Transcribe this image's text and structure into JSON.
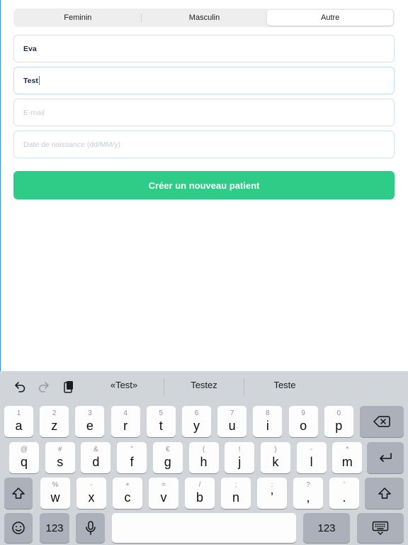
{
  "gender_segments": [
    {
      "label": "Feminin",
      "selected": false
    },
    {
      "label": "Masculin",
      "selected": false
    },
    {
      "label": "Autre",
      "selected": true
    }
  ],
  "form": {
    "first_name_value": "Eva",
    "last_name_value": "Test",
    "email_placeholder": "E-mail",
    "birthdate_placeholder": "Date de naissance (dd/MM/y)"
  },
  "create_button_label": "Créer un nouveau patient",
  "keyboard": {
    "suggestions": [
      "«Test»",
      "Testez",
      "Teste"
    ],
    "row1": [
      {
        "sec": "1",
        "pri": "a"
      },
      {
        "sec": "2",
        "pri": "z"
      },
      {
        "sec": "3",
        "pri": "e"
      },
      {
        "sec": "4",
        "pri": "r"
      },
      {
        "sec": "5",
        "pri": "t"
      },
      {
        "sec": "6",
        "pri": "y"
      },
      {
        "sec": "7",
        "pri": "u"
      },
      {
        "sec": "8",
        "pri": "i"
      },
      {
        "sec": "9",
        "pri": "o"
      },
      {
        "sec": "0",
        "pri": "p"
      }
    ],
    "row2": [
      {
        "sec": "@",
        "pri": "q"
      },
      {
        "sec": "#",
        "pri": "s"
      },
      {
        "sec": "&",
        "pri": "d"
      },
      {
        "sec": "”",
        "pri": "f"
      },
      {
        "sec": "€",
        "pri": "g"
      },
      {
        "sec": "(",
        "pri": "h"
      },
      {
        "sec": "!",
        "pri": "j"
      },
      {
        "sec": ")",
        "pri": "k"
      },
      {
        "sec": "-",
        "pri": "l"
      },
      {
        "sec": "*",
        "pri": "m"
      }
    ],
    "row3": [
      {
        "sec": "%",
        "pri": "w"
      },
      {
        "sec": "-",
        "pri": "x"
      },
      {
        "sec": "+",
        "pri": "c"
      },
      {
        "sec": "=",
        "pri": "v"
      },
      {
        "sec": "/",
        "pri": "b"
      },
      {
        "sec": ";",
        "pri": "n"
      },
      {
        "sec": ":",
        "pri": "’"
      },
      {
        "sec": "?",
        "pri": ","
      },
      {
        "sec": "’",
        "pri": "."
      }
    ],
    "numbers_label": "123",
    "icons": {
      "undo": "undo-icon",
      "redo": "redo-icon",
      "paste": "paste-icon",
      "delete": "delete-icon",
      "return": "return-icon",
      "shift": "shift-icon",
      "emoji": "emoji-icon",
      "mic": "microphone-icon",
      "dismiss": "keyboard-dismiss-icon"
    }
  },
  "colors": {
    "primary_button": "#2ecc87",
    "field_border": "#cfe4f2",
    "keyboard_bg": "#d1d4d9"
  }
}
